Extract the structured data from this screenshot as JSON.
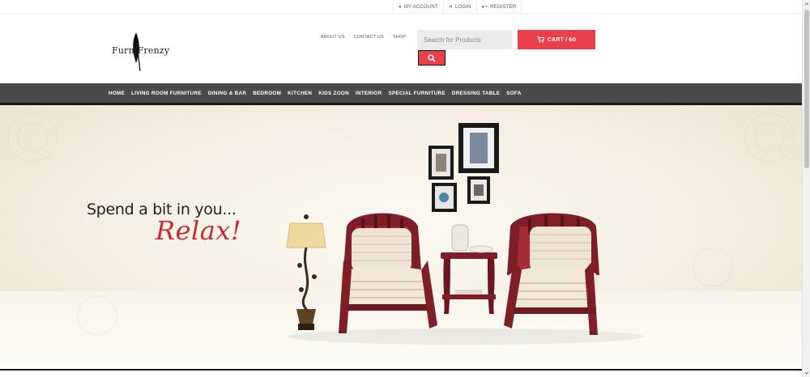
{
  "topbar": {
    "links": [
      {
        "icon": "user-icon",
        "label": "MY ACCOUNT"
      },
      {
        "icon": "sign-in-icon",
        "label": "LOGIN"
      },
      {
        "icon": "user-plus-icon",
        "label": "REGISTER"
      }
    ]
  },
  "header": {
    "logo_text": "FurniFrenzy",
    "nav": [
      "ABOUT US",
      "CONTACT US",
      "SHOP"
    ],
    "search": {
      "placeholder": "Search for Products",
      "icon": "search-icon"
    },
    "cart": {
      "label": "CART / ₺0",
      "icon": "cart-icon"
    }
  },
  "categories": [
    "HOME",
    "LIVING ROOM FURNITURE",
    "DINING & BAR",
    "BEDROOM",
    "KITCHEN",
    "KIDS ZOON",
    "INTERIOR",
    "SPECIAL FURNITURE",
    "DRESSING TABLE",
    "SOFA"
  ],
  "hero": {
    "tagline": "Spend a bit in you...",
    "highlight": "Relax!"
  },
  "colors": {
    "accent": "#ea3f47",
    "category_bar": "#4a4a4a",
    "relax_text": "#c62a35",
    "chair_wood": "#7e1f27"
  }
}
